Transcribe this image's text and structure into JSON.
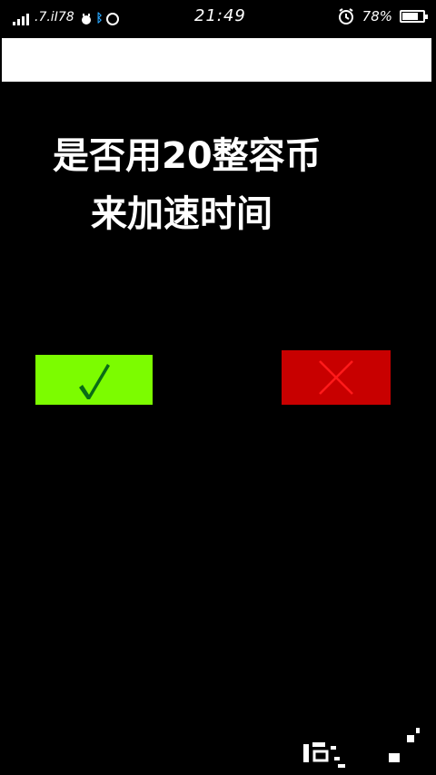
{
  "status_bar": {
    "network_text": ".7.iI78",
    "time": "21:49",
    "battery_percent_text": "78%",
    "battery_level": 0.78
  },
  "dialog": {
    "line_1": "是否用20整容币",
    "line_2": "来加速时间"
  },
  "buttons": {
    "confirm_icon": "checkmark-icon",
    "cancel_icon": "close-x-icon"
  },
  "colors": {
    "background": "#000000",
    "title_bar": "#ffffff",
    "confirm_button": "#7cfc00",
    "confirm_glyph": "#0a6b16",
    "cancel_button": "#c80000",
    "cancel_glyph": "#ff1a1a",
    "bluetooth_accent": "#29a8ff"
  }
}
